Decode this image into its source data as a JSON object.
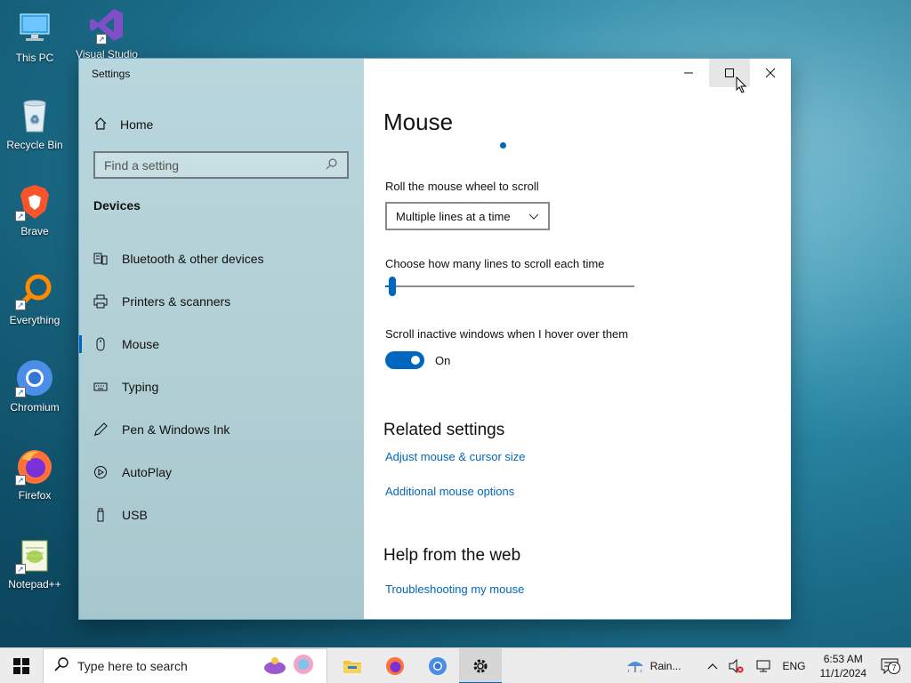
{
  "desktop": {
    "icons": [
      {
        "label": "This PC",
        "icon": "computer-icon"
      },
      {
        "label": "Visual Studio",
        "icon": "visual-studio-icon"
      },
      {
        "label": "Recycle Bin",
        "icon": "recycle-bin-icon"
      },
      {
        "label": "Brave",
        "icon": "brave-icon"
      },
      {
        "label": "Everything",
        "icon": "everything-search-icon"
      },
      {
        "label": "Chromium",
        "icon": "chromium-icon"
      },
      {
        "label": "Firefox",
        "icon": "firefox-icon"
      },
      {
        "label": "Notepad++",
        "icon": "notepad-plus-plus-icon"
      }
    ]
  },
  "window": {
    "title": "Settings",
    "sidebar": {
      "home_label": "Home",
      "search_placeholder": "Find a setting",
      "section_title": "Devices",
      "items": [
        {
          "label": "Bluetooth & other devices",
          "icon": "bluetooth-devices-icon"
        },
        {
          "label": "Printers & scanners",
          "icon": "printer-icon"
        },
        {
          "label": "Mouse",
          "icon": "mouse-icon",
          "active": true
        },
        {
          "label": "Typing",
          "icon": "keyboard-icon"
        },
        {
          "label": "Pen & Windows Ink",
          "icon": "pen-icon"
        },
        {
          "label": "AutoPlay",
          "icon": "autoplay-icon"
        },
        {
          "label": "USB",
          "icon": "usb-icon"
        }
      ]
    },
    "content": {
      "page_title": "Mouse",
      "wheel_label": "Roll the mouse wheel to scroll",
      "wheel_value": "Multiple lines at a time",
      "lines_label": "Choose how many lines to scroll each time",
      "lines_slider_fraction": 0.02,
      "inactive_label": "Scroll inactive windows when I hover over them",
      "inactive_state": "On",
      "related_title": "Related settings",
      "related_links": [
        "Adjust mouse & cursor size",
        "Additional mouse options"
      ],
      "help_title": "Help from the web",
      "help_links": [
        "Troubleshooting my mouse"
      ]
    }
  },
  "taskbar": {
    "search_placeholder": "Type here to search",
    "weather": "Rain...",
    "language": "ENG",
    "time": "6:53 AM",
    "date": "11/1/2024",
    "notification_count": "7"
  },
  "colors": {
    "accent": "#0067c0",
    "link": "#0067b8",
    "sidebar_bg": "#b3d0d6",
    "taskbar_bg": "#ececec"
  }
}
